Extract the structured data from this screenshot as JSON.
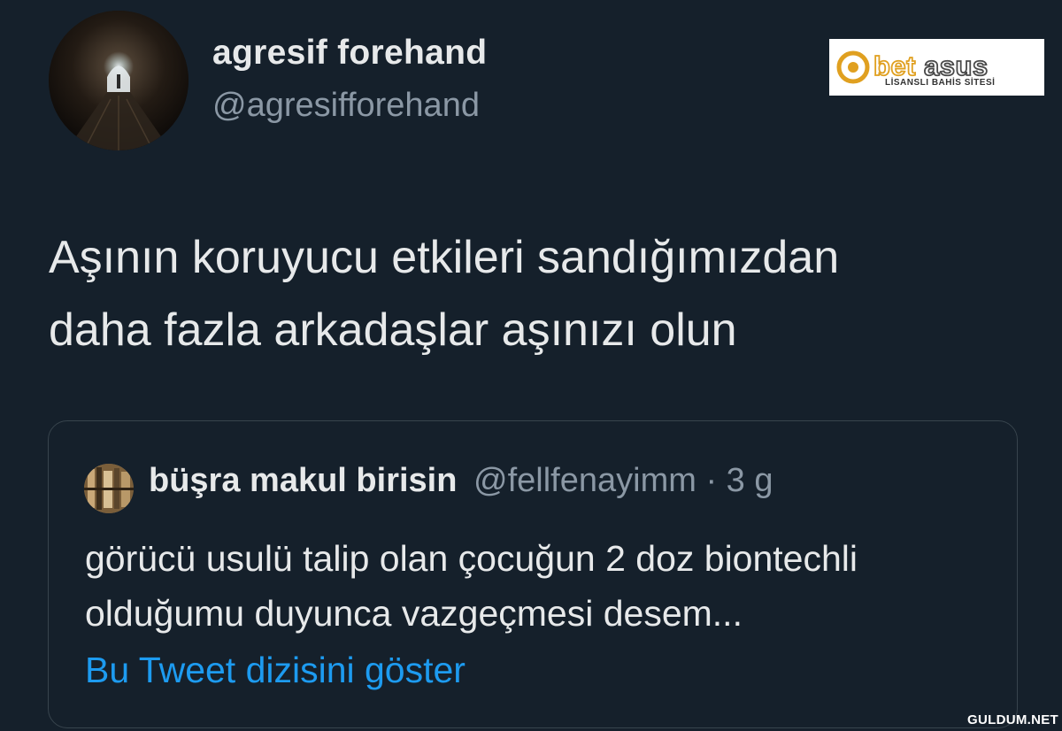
{
  "author": {
    "display_name": "agresif forehand",
    "handle": "@agresifforehand"
  },
  "tweet": {
    "line1": "Aşının koruyucu etkileri sandığımızdan",
    "line2": "daha fazla arkadaşlar aşınızı olun"
  },
  "quoted_tweet": {
    "display_name": "büşra makul birisin",
    "handle": "@fellfenayimm",
    "separator": " · ",
    "age": "3 g",
    "line1": "görücü usulü talip olan çocuğun 2 doz biontechli",
    "line2": "olduğumu duyunca vazgeçmesi desem...",
    "thread_link": "Bu Tweet dizisini göster"
  },
  "ad": {
    "brand": "betasus",
    "tagline": "LİSANSLI BAHİS SİTESİ",
    "accent": "#e0a020"
  },
  "watermark": "GULDUM.NET",
  "colors": {
    "background": "#15202b",
    "link": "#1d9bf0",
    "muted": "#8b98a5"
  }
}
